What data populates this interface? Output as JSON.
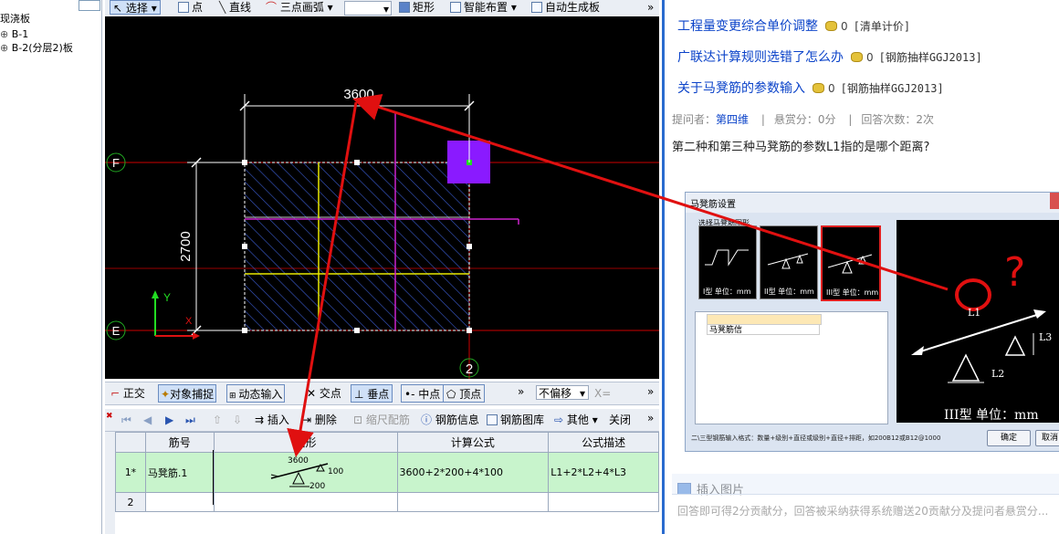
{
  "tree": {
    "items": [
      "现浇板",
      "B-1",
      "B-2(分层2)板"
    ]
  },
  "top_toolbar": {
    "select": "选择",
    "point": "点",
    "line": "直线",
    "arc": "三点画弧",
    "rect": "矩形",
    "smart": "智能布置",
    "auto": "自动生成板",
    "more": "»"
  },
  "canvas": {
    "dim_h": "3600",
    "dim_v": "2700",
    "axis_f": "F",
    "axis_e": "E",
    "axis_2": "2",
    "axis_y": "Y",
    "axis_x": "X"
  },
  "snap_bar": {
    "ortho": "正交",
    "snap": "对象捕捉",
    "dynamic": "动态输入",
    "intersection": "交点",
    "perpendicular": "垂点",
    "midpoint": "中点",
    "vertex": "顶点",
    "more": "»",
    "offset": "不偏移",
    "x_field": "X=",
    "more2": "»"
  },
  "rebar_bar": {
    "insert": "插入",
    "delete": "删除",
    "scale": "缩尺配筋",
    "info": "钢筋信息",
    "library": "钢筋图库",
    "other": "其他",
    "close": "关闭",
    "more": "»"
  },
  "grid": {
    "headers": [
      "筋号",
      "图形",
      "计算公式",
      "公式描述"
    ],
    "rows": [
      {
        "num": "1*",
        "name": "马凳筋.1",
        "shape_top": "3600",
        "shape_right": "100",
        "shape_bottom": "200",
        "formula": "3600+2*200+4*100",
        "desc": "L1+2*L2+4*L3"
      },
      {
        "num": "2",
        "name": "",
        "formula": "",
        "desc": ""
      }
    ]
  },
  "qa": {
    "links": [
      {
        "title": "工程量变更综合单价调整",
        "count": "0",
        "tag": "[清单计价]"
      },
      {
        "title": "广联达计算规则选错了怎么办",
        "count": "0",
        "tag": "[钢筋抽样GGJ2013]"
      },
      {
        "title": "关于马凳筋的参数输入",
        "count": "0",
        "tag": "[钢筋抽样GGJ2013]"
      }
    ],
    "meta_asker_label": "提问者：",
    "meta_asker": "第四维",
    "meta_sep": "|",
    "meta_reward": "悬赏分：0分",
    "meta_answers": "回答次数：2次",
    "question": "第二种和第三种马凳筋的参数L1指的是哪个距离?"
  },
  "dialog": {
    "title": "马凳筋设置",
    "group_label": "选择马凳筋图形",
    "thumbs": [
      "I型 单位：mm",
      "II型 单位：mm",
      "III型 单位：mm"
    ],
    "table_row_label": "马凳筋信",
    "hint": "二\\三型钢筋输入格式：数量+级别+直径或级别+直径+排距，如200B12或B12@1000",
    "ok": "确定",
    "cancel": "取消",
    "big_caption": "III型  单位：mm",
    "big_l1": "L1",
    "big_l2": "L2",
    "big_l3": "L3",
    "question_mark": "?"
  },
  "insert_image": "插入图片",
  "answer_placeholder": "回答即可得2分贡献分，回答被采纳获得系统赠送20贡献分及提问者悬赏分...",
  "colors": {
    "canvas_bg": "#000000",
    "slab_outline": "#ffffff",
    "axis_red": "#d40000",
    "arrow_red": "#e01010",
    "magenta": "#cc22cc",
    "yellow": "#e8e800",
    "purple_box": "#8a1aff",
    "hatch_blue": "#3a5bd0",
    "link_blue": "#0b43c9",
    "row_green": "#c8f4cc",
    "accent_blue": "#2a6bcf"
  }
}
